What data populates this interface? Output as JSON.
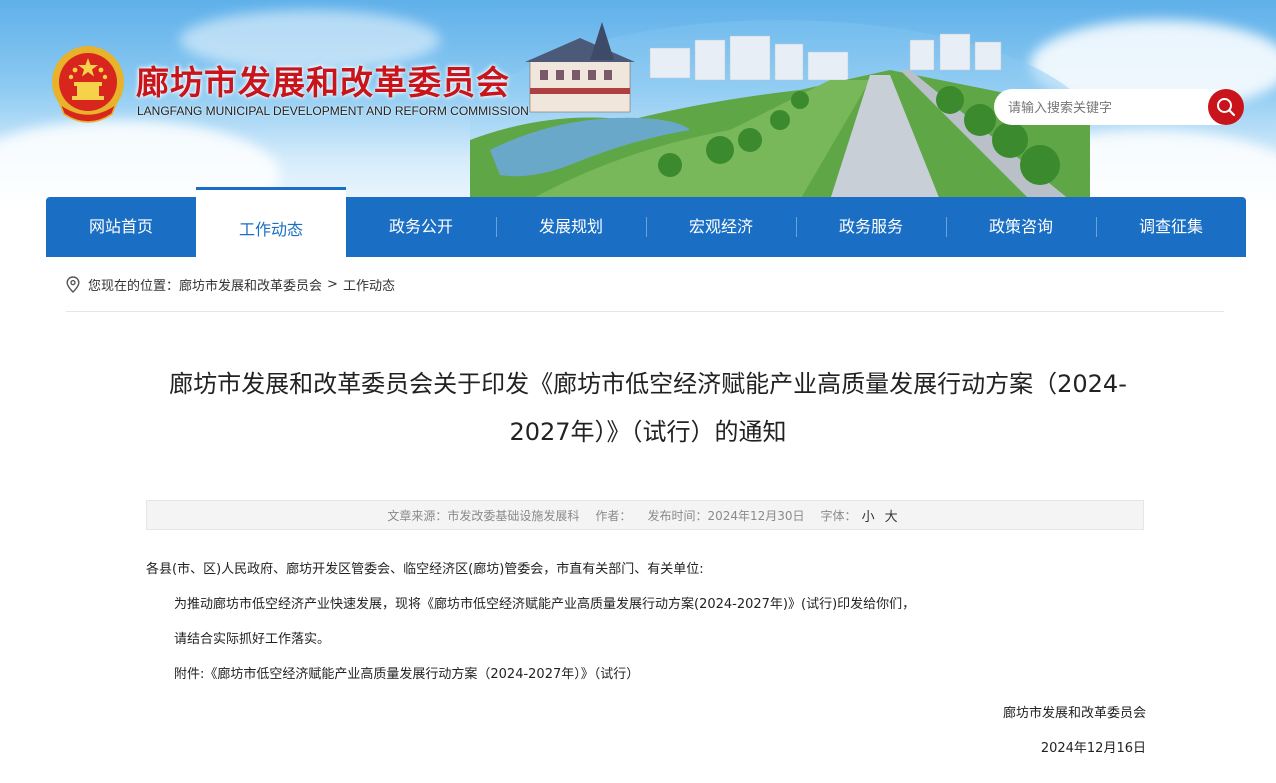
{
  "header": {
    "title": "廊坊市发展和改革委员会",
    "subtitle": "LANGFANG MUNICIPAL DEVELOPMENT AND REFORM COMMISSION",
    "brand_color": "#c8141a"
  },
  "search": {
    "placeholder": "请输入搜索关键字",
    "icon": "search-icon"
  },
  "nav": {
    "color": "#1a6fc4",
    "items": [
      {
        "label": "网站首页"
      },
      {
        "label": "工作动态",
        "active": true
      },
      {
        "label": "政务公开"
      },
      {
        "label": "发展规划"
      },
      {
        "label": "宏观经济"
      },
      {
        "label": "政务服务"
      },
      {
        "label": "政策咨询"
      },
      {
        "label": "调查征集"
      }
    ]
  },
  "breadcrumb": {
    "icon": "location-pin-icon",
    "prefix": "您现在的位置：",
    "items": [
      "廊坊市发展和改革委员会",
      "工作动态"
    ],
    "separator": ">"
  },
  "article": {
    "title_line1": "廊坊市发展和改革委员会关于印发《廊坊市低空经济赋能产业高质量发展行动方案（2024-",
    "title_line2": "2027年）》（试行）的通知",
    "meta": {
      "source_label": "文章来源：",
      "source": "市发改委基础设施发展科",
      "author_label": "作者：",
      "author": "",
      "time_label": "发布时间：",
      "time": "2024年12月30日",
      "font_label": "字体：",
      "font_small": "小",
      "font_large": "大"
    },
    "paragraphs": [
      "各县(市、区)人民政府、廊坊开发区管委会、临空经济区(廊坊)管委会，市直有关部门、有关单位:",
      "为推动廊坊市低空经济产业快速发展，现将《廊坊市低空经济赋能产业高质量发展行动方案(2024-2027年)》(试行)印发给你们，",
      "请结合实际抓好工作落实。",
      "附件:《廊坊市低空经济赋能产业高质量发展行动方案（2024-2027年）》（试行）"
    ],
    "signature": "廊坊市发展和改革委员会",
    "date": "2024年12月16日"
  }
}
